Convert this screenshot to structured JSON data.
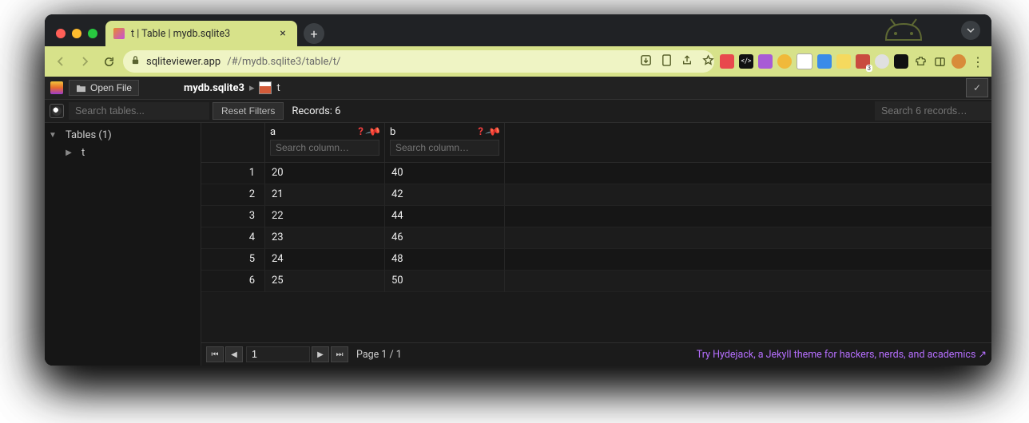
{
  "browser": {
    "tab_title": "t | Table | mydb.sqlite3",
    "url_host": "sqliteviewer.app",
    "url_path": "/#/mydb.sqlite3/table/t/"
  },
  "app": {
    "open_file_label": "Open File",
    "breadcrumb": {
      "database": "mydb.sqlite3",
      "table": "t"
    },
    "search_tables_placeholder": "Search tables...",
    "reset_filters_label": "Reset Filters",
    "records_label": "Records: 6",
    "search_records_placeholder": "Search 6 records…",
    "sidebar": {
      "group_label": "Tables (1)",
      "items": [
        "t"
      ]
    },
    "columns": [
      {
        "name": "a",
        "search_placeholder": "Search column…"
      },
      {
        "name": "b",
        "search_placeholder": "Search column…"
      }
    ],
    "rows": [
      {
        "n": "1",
        "a": "20",
        "b": "40"
      },
      {
        "n": "2",
        "a": "21",
        "b": "42"
      },
      {
        "n": "3",
        "a": "22",
        "b": "44"
      },
      {
        "n": "4",
        "a": "23",
        "b": "46"
      },
      {
        "n": "5",
        "a": "24",
        "b": "48"
      },
      {
        "n": "6",
        "a": "25",
        "b": "50"
      }
    ],
    "pagination": {
      "current": "1",
      "label": "Page 1 / 1"
    },
    "promo": "Try Hydejack, a Jekyll theme for hackers, nerds, and academics ↗"
  }
}
